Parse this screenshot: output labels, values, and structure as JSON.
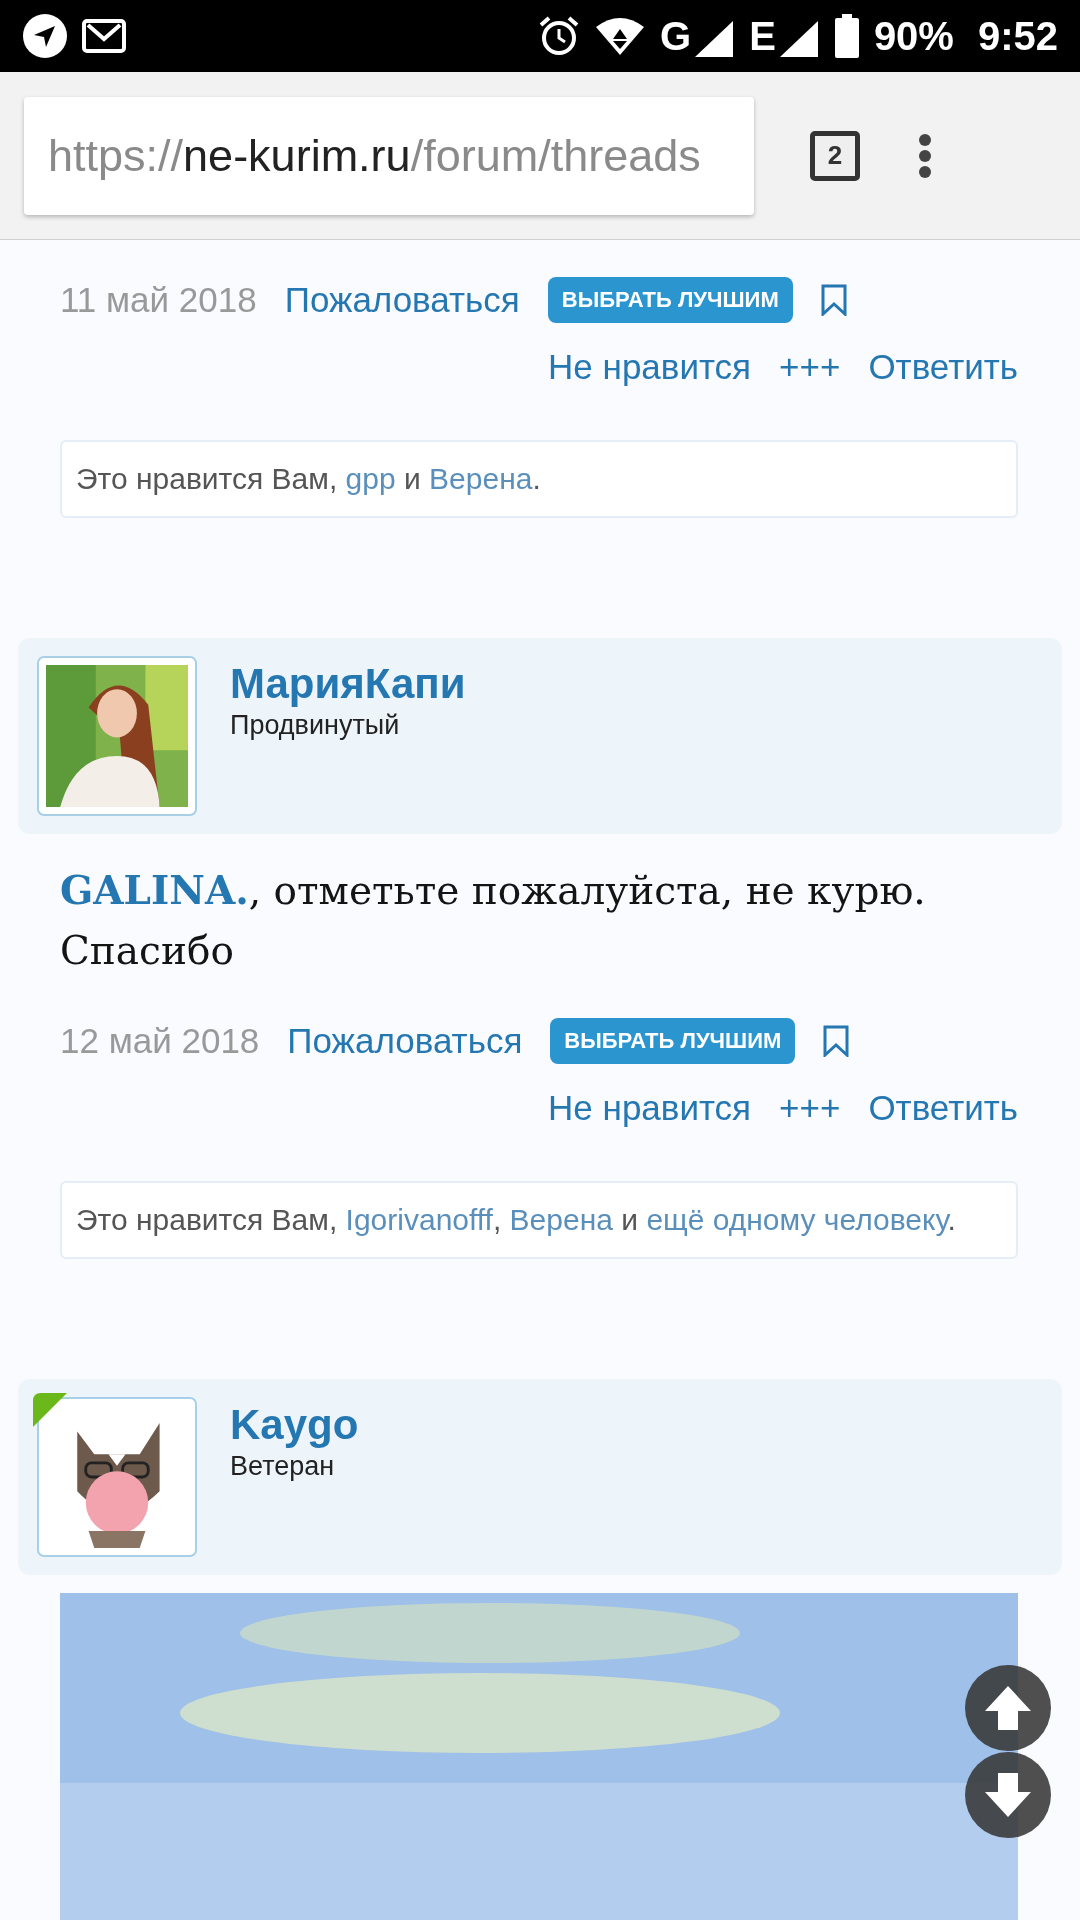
{
  "status_bar": {
    "network": [
      "G",
      "E"
    ],
    "battery": "90%",
    "time": "9:52"
  },
  "browser": {
    "url_scheme": "https://",
    "url_domain": "ne-kurim.ru",
    "url_path": "/forum/threads",
    "tab_count": "2"
  },
  "posts": [
    {
      "footer": {
        "date": "11 май 2018",
        "report": "Пожаловаться",
        "best_button": "ВЫБРАТЬ ЛУЧШИМ",
        "dislike": "Не нравится",
        "plus": "+++",
        "reply": "Ответить"
      },
      "likes": [
        {
          "kind": "text",
          "text": "Это нравится Вам, "
        },
        {
          "kind": "link",
          "text": "gpp"
        },
        {
          "kind": "text",
          "text": " и "
        },
        {
          "kind": "link",
          "text": "Верена"
        },
        {
          "kind": "text",
          "text": "."
        }
      ]
    },
    {
      "user": {
        "name": "МарияКапи",
        "rank": "Продвинутый",
        "online": false
      },
      "message": {
        "mention": "GALINA.",
        "text": ", отметьте пожалуйста, не курю. Спасибо"
      },
      "footer": {
        "date": "12 май 2018",
        "report": "Пожаловаться",
        "best_button": "ВЫБРАТЬ ЛУЧШИМ",
        "dislike": "Не нравится",
        "plus": "+++",
        "reply": "Ответить"
      },
      "likes": [
        {
          "kind": "text",
          "text": "Это нравится Вам, "
        },
        {
          "kind": "link",
          "text": "Igorivanofff"
        },
        {
          "kind": "text",
          "text": ", "
        },
        {
          "kind": "link",
          "text": "Верена"
        },
        {
          "kind": "text",
          "text": " и "
        },
        {
          "kind": "link",
          "text": "ещё одному человеку"
        },
        {
          "kind": "text",
          "text": "."
        }
      ]
    },
    {
      "user": {
        "name": "Kaygo",
        "rank": "Ветеран",
        "online": true
      }
    }
  ]
}
